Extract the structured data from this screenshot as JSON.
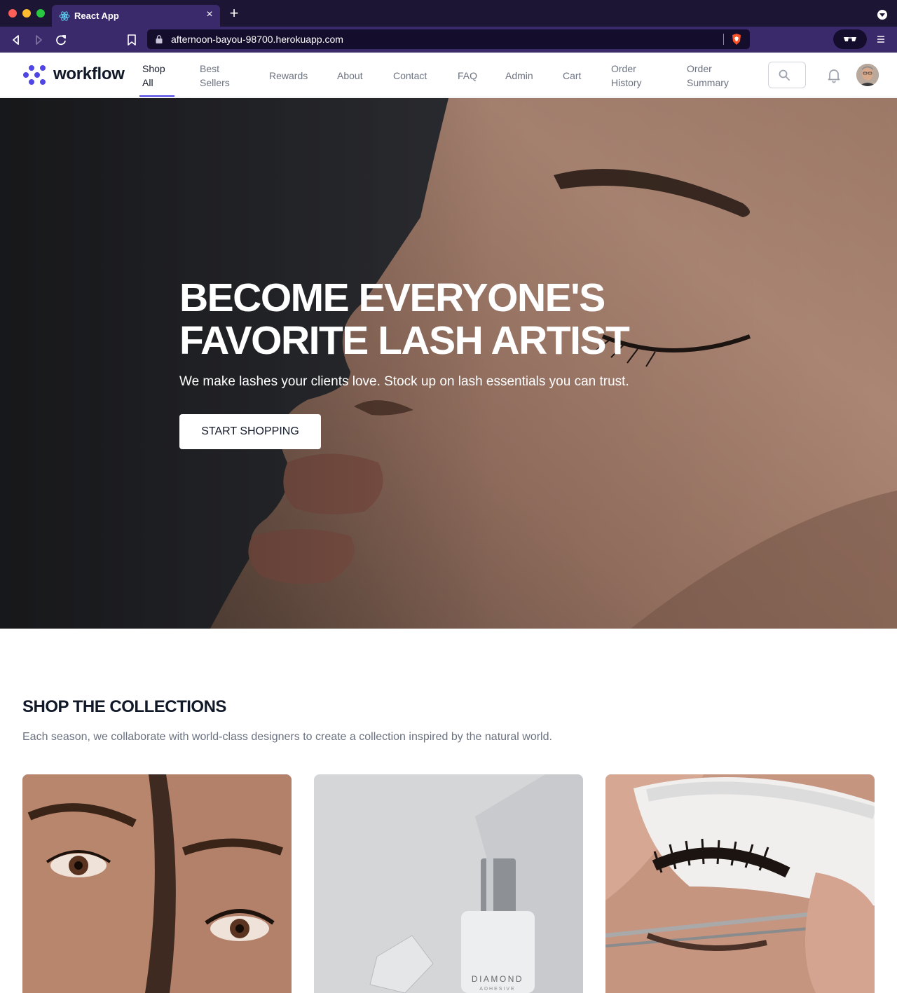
{
  "browser": {
    "tab_title": "React App",
    "tab_close": "×",
    "new_tab": "+",
    "url": "afternoon-bayou-98700.herokuapp.com"
  },
  "header": {
    "logo_text": "workflow",
    "nav": [
      {
        "label": "Shop All",
        "active": true
      },
      {
        "label": "Best Sellers",
        "active": false
      },
      {
        "label": "Rewards",
        "active": false
      },
      {
        "label": "About",
        "active": false
      },
      {
        "label": "Contact",
        "active": false
      },
      {
        "label": "FAQ",
        "active": false
      },
      {
        "label": "Admin",
        "active": false
      },
      {
        "label": "Cart",
        "active": false
      },
      {
        "label": "Order History",
        "active": false
      },
      {
        "label": "Order Summary",
        "active": false
      }
    ],
    "icons": [
      "search-icon",
      "bell-icon",
      "avatar"
    ]
  },
  "hero": {
    "title": "BECOME EVERYONE'S FAVORITE LASH ARTIST",
    "subtitle": "We make lashes your clients love. Stock up on lash essentials you can trust.",
    "cta_label": "START SHOPPING"
  },
  "collections": {
    "title": "SHOP THE COLLECTIONS",
    "description": "Each season, we collaborate with world-class designers to create a collection inspired by the natural world.",
    "product_bottle_label": "DIAMOND",
    "product_bottle_sublabel": "ADHESIVE"
  },
  "colors": {
    "brand": "#4f46e5",
    "browser_frame": "#3a2a6b",
    "heading": "#111827",
    "muted_text": "#6b7280"
  }
}
